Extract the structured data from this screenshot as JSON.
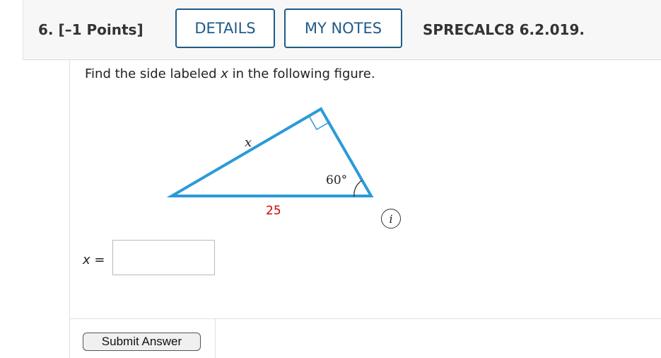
{
  "header": {
    "question_number": "6.",
    "points": "[–1 Points]",
    "details_label": "DETAILS",
    "my_notes_label": "MY NOTES",
    "problem_code": "SPRECALC8 6.2.019."
  },
  "question": {
    "prompt_before": "Find the side labeled ",
    "prompt_var": "x",
    "prompt_after": " in the following figure."
  },
  "figure": {
    "side_label": "x",
    "angle_label": "60°",
    "base_label": "25",
    "line_color": "#2a9ad9",
    "base_label_color": "#cc0000"
  },
  "info_icon": "i",
  "answer": {
    "label_var": "x",
    "label_eq": " =",
    "value": ""
  },
  "submit_label": "Submit Answer"
}
